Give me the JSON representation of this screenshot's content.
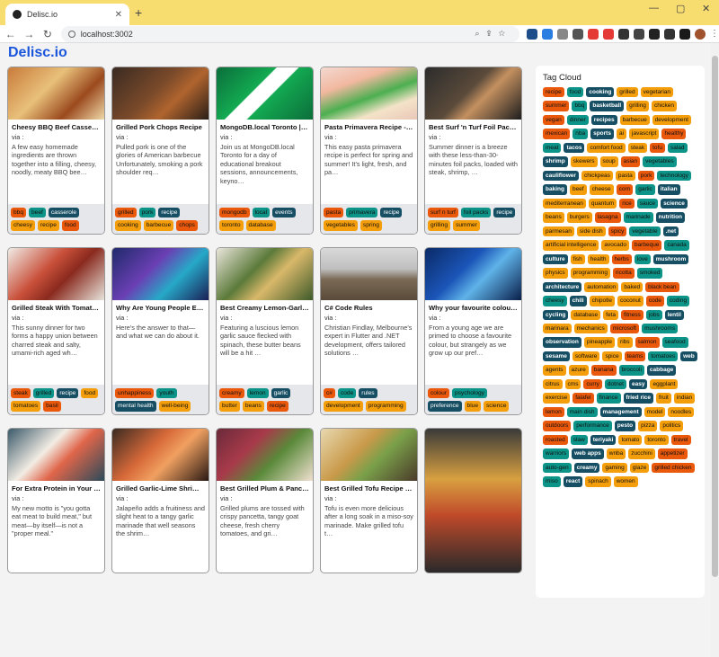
{
  "browser": {
    "tab_title": "Delisc.io",
    "tab_close": "✕",
    "new_tab": "+",
    "url": "localhost:3002",
    "back": "←",
    "forward": "→",
    "reload": "↻",
    "win_min": "—",
    "win_max": "▢",
    "win_close": "✕"
  },
  "brand": "Delisc.io",
  "colors": {
    "orange": "#f59e0b",
    "red": "#ea580c",
    "teal": "#0d9488",
    "navy": "#164e63",
    "green": "#a7f3d0",
    "yellow": "#fbbf24"
  },
  "cards": [
    {
      "title": "Cheesy BBQ Beef Casserol…",
      "via": "via :",
      "desc": "A few easy homemade ingredients are thrown together into a filling, cheesy, noodly, meaty BBQ bee…",
      "tags": [
        [
          "bbq",
          "red"
        ],
        [
          "beef",
          "teal"
        ],
        [
          "casserole",
          "navy"
        ],
        [
          "cheesy",
          "orange"
        ],
        [
          "recipe",
          "orange"
        ],
        [
          "food",
          "red"
        ]
      ]
    },
    {
      "title": "Grilled Pork Chops Recipe",
      "via": "via :",
      "desc": "Pulled pork is one of the glories of American barbecue Unfortunately, smoking a pork shoulder req…",
      "tags": [
        [
          "grilled",
          "red"
        ],
        [
          "pork",
          "teal"
        ],
        [
          "recipe",
          "navy"
        ],
        [
          "cooking",
          "orange"
        ],
        [
          "barbecue",
          "orange"
        ],
        [
          "chops",
          "red"
        ]
      ]
    },
    {
      "title": "MongoDB.local Toronto | …",
      "via": "via :",
      "desc": "Join us at MongoDB.local Toronto for a day of educational breakout sessions, announcements, keyno…",
      "tags": [
        [
          "mongodb",
          "red"
        ],
        [
          "local",
          "teal"
        ],
        [
          "events",
          "navy"
        ],
        [
          "toronto",
          "orange"
        ],
        [
          "database",
          "orange"
        ]
      ]
    },
    {
      "title": "Pasta Primavera Recipe - L…",
      "via": "via :",
      "desc": "This easy pasta primavera recipe is perfect for spring and summer! It's light, fresh, and pa…",
      "tags": [
        [
          "pasta",
          "red"
        ],
        [
          "primavera",
          "teal"
        ],
        [
          "recipe",
          "navy"
        ],
        [
          "vegetables",
          "orange"
        ],
        [
          "spring",
          "orange"
        ]
      ]
    },
    {
      "title": "Best Surf 'n Turf Foil Packs…",
      "via": "via :",
      "desc": "Summer dinner is a breeze with these less-than-30-minutes foil packs, loaded with steak, shrimp, …",
      "tags": [
        [
          "surf n turf",
          "red"
        ],
        [
          "foil packs",
          "teal"
        ],
        [
          "recipe",
          "navy"
        ],
        [
          "grilling",
          "orange"
        ],
        [
          "summer",
          "orange"
        ]
      ]
    },
    {
      "title": "Grilled Steak With Tomato…",
      "via": "via :",
      "desc": "This sunny dinner for two forms a happy union between charred steak and salty, umami-rich aged wh…",
      "tags": [
        [
          "steak",
          "red"
        ],
        [
          "grilled",
          "teal"
        ],
        [
          "recipe",
          "navy"
        ],
        [
          "food",
          "orange"
        ],
        [
          "tomatoes",
          "orange"
        ],
        [
          "basil",
          "red"
        ]
      ]
    },
    {
      "title": "Why Are Young People Ev…",
      "via": "via :",
      "desc": "Here's the answer to that—and what we can do about it.",
      "tags": [
        [
          "unhappiness",
          "red"
        ],
        [
          "youth",
          "teal"
        ],
        [
          "mental health",
          "navy"
        ],
        [
          "well-being",
          "orange"
        ]
      ]
    },
    {
      "title": "Best Creamy Lemon-Garlic…",
      "via": "via :",
      "desc": "Featuring a luscious lemon garlic sauce flecked with spinach, these butter beans will be a hit …",
      "tags": [
        [
          "creamy",
          "red"
        ],
        [
          "lemon",
          "teal"
        ],
        [
          "garlic",
          "navy"
        ],
        [
          "butter",
          "orange"
        ],
        [
          "beans",
          "orange"
        ],
        [
          "recipe",
          "red"
        ]
      ]
    },
    {
      "title": "C# Code Rules",
      "via": "via :",
      "desc": "Christian Findlay, Melbourne's expert in Flutter and .NET development, offers tailored solutions …",
      "tags": [
        [
          "c#",
          "red"
        ],
        [
          "code",
          "teal"
        ],
        [
          "rules",
          "navy"
        ],
        [
          "development",
          "orange"
        ],
        [
          "programming",
          "orange"
        ]
      ]
    },
    {
      "title": "Why your favourite colour…",
      "via": "via :",
      "desc": "From a young age we are primed to choose a favourite colour, but strangely as we grow up our pref…",
      "tags": [
        [
          "colour",
          "red"
        ],
        [
          "psychology",
          "teal"
        ],
        [
          "preference",
          "navy"
        ],
        [
          "blue",
          "orange"
        ],
        [
          "science",
          "orange"
        ]
      ]
    },
    {
      "title": "For Extra Protein in Your B…",
      "via": "via :",
      "desc": "My new motto is \"you gotta eat meat to build meat,\" but meat—by itself—is not a \"proper meal.\"",
      "tags": []
    },
    {
      "title": "Grilled Garlic-Lime Shrimp…",
      "via": "via :",
      "desc": "Jalapeño adds a fruitiness and slight heat to a tangy garlic marinade that well seasons the shrim…",
      "tags": []
    },
    {
      "title": "Best Grilled Plum & Pance…",
      "via": "via :",
      "desc": "Grilled plums are tossed with crispy pancetta, tangy goat cheese, fresh cherry tomatoes, and gri…",
      "tags": []
    },
    {
      "title": "Best Grilled Tofu Recipe - …",
      "via": "via :",
      "desc": "Tofu is even more delicious after a long soak in a miso-soy marinade. Make grilled tofu t…",
      "tags": []
    },
    {
      "title": "",
      "via": "",
      "desc": "",
      "tags": []
    }
  ],
  "tag_cloud": {
    "title": "Tag Cloud",
    "tags": [
      [
        "recipe",
        "red"
      ],
      [
        "food",
        "teal"
      ],
      [
        "cooking",
        "navy"
      ],
      [
        "grilled",
        "orange"
      ],
      [
        "vegetarian",
        "orange"
      ],
      [
        "summer",
        "red"
      ],
      [
        "bbq",
        "teal"
      ],
      [
        "basketball",
        "navy"
      ],
      [
        "grilling",
        "orange"
      ],
      [
        "chicken",
        "orange"
      ],
      [
        "vegan",
        "red"
      ],
      [
        "dinner",
        "teal"
      ],
      [
        "recipes",
        "navy"
      ],
      [
        "barbecue",
        "orange"
      ],
      [
        "development",
        "orange"
      ],
      [
        "mexican",
        "red"
      ],
      [
        "nba",
        "teal"
      ],
      [
        "sports",
        "navy"
      ],
      [
        "ai",
        "orange"
      ],
      [
        "javascript",
        "orange"
      ],
      [
        "healthy",
        "red"
      ],
      [
        "meat",
        "teal"
      ],
      [
        "tacos",
        "navy"
      ],
      [
        "comfort food",
        "orange"
      ],
      [
        "steak",
        "orange"
      ],
      [
        "tofu",
        "red"
      ],
      [
        "salad",
        "teal"
      ],
      [
        "shrimp",
        "navy"
      ],
      [
        "skewers",
        "orange"
      ],
      [
        "soup",
        "orange"
      ],
      [
        "asian",
        "red"
      ],
      [
        "vegetables",
        "teal"
      ],
      [
        "cauliflower",
        "navy"
      ],
      [
        "chickpeas",
        "orange"
      ],
      [
        "pasta",
        "orange"
      ],
      [
        "pork",
        "red"
      ],
      [
        "technology",
        "teal"
      ],
      [
        "baking",
        "navy"
      ],
      [
        "beef",
        "orange"
      ],
      [
        "cheese",
        "orange"
      ],
      [
        "corn",
        "red"
      ],
      [
        "garlic",
        "teal"
      ],
      [
        "italian",
        "navy"
      ],
      [
        "mediterranean",
        "orange"
      ],
      [
        "quantum",
        "orange"
      ],
      [
        "rice",
        "red"
      ],
      [
        "sauce",
        "teal"
      ],
      [
        "science",
        "navy"
      ],
      [
        "beans",
        "orange"
      ],
      [
        "burgers",
        "orange"
      ],
      [
        "lasagna",
        "red"
      ],
      [
        "marinade",
        "teal"
      ],
      [
        "nutrition",
        "navy"
      ],
      [
        "parmesan",
        "orange"
      ],
      [
        "side dish",
        "orange"
      ],
      [
        "spicy",
        "red"
      ],
      [
        "vegetable",
        "teal"
      ],
      [
        ".net",
        "navy"
      ],
      [
        "artificial intelligence",
        "orange"
      ],
      [
        "avocado",
        "orange"
      ],
      [
        "barbeque",
        "red"
      ],
      [
        "canada",
        "teal"
      ],
      [
        "culture",
        "navy"
      ],
      [
        "fish",
        "orange"
      ],
      [
        "health",
        "orange"
      ],
      [
        "herbs",
        "red"
      ],
      [
        "love",
        "teal"
      ],
      [
        "mushroom",
        "navy"
      ],
      [
        "physics",
        "orange"
      ],
      [
        "programming",
        "orange"
      ],
      [
        "ricotta",
        "red"
      ],
      [
        "smoked",
        "teal"
      ],
      [
        "architecture",
        "navy"
      ],
      [
        "automation",
        "orange"
      ],
      [
        "baked",
        "orange"
      ],
      [
        "black bean",
        "red"
      ],
      [
        "cheesy",
        "teal"
      ],
      [
        "chili",
        "navy"
      ],
      [
        "chipotle",
        "orange"
      ],
      [
        "coconut",
        "orange"
      ],
      [
        "code",
        "red"
      ],
      [
        "coding",
        "teal"
      ],
      [
        "cycling",
        "navy"
      ],
      [
        "database",
        "orange"
      ],
      [
        "feta",
        "orange"
      ],
      [
        "fitness",
        "red"
      ],
      [
        "jobs",
        "teal"
      ],
      [
        "lentil",
        "navy"
      ],
      [
        "marinara",
        "orange"
      ],
      [
        "mechanics",
        "orange"
      ],
      [
        "microsoft",
        "red"
      ],
      [
        "mushrooms",
        "teal"
      ],
      [
        "observation",
        "navy"
      ],
      [
        "pineapple",
        "orange"
      ],
      [
        "ribs",
        "orange"
      ],
      [
        "salmon",
        "red"
      ],
      [
        "seafood",
        "teal"
      ],
      [
        "sesame",
        "navy"
      ],
      [
        "software",
        "orange"
      ],
      [
        "spice",
        "orange"
      ],
      [
        "teams",
        "red"
      ],
      [
        "tomatoes",
        "teal"
      ],
      [
        "web",
        "navy"
      ],
      [
        "agents",
        "orange"
      ],
      [
        "azure",
        "orange"
      ],
      [
        "banana",
        "red"
      ],
      [
        "broccoli",
        "teal"
      ],
      [
        "cabbage",
        "navy"
      ],
      [
        "citrus",
        "orange"
      ],
      [
        "cms",
        "orange"
      ],
      [
        "curry",
        "red"
      ],
      [
        "dotnet",
        "teal"
      ],
      [
        "easy",
        "navy"
      ],
      [
        "eggplant",
        "orange"
      ],
      [
        "exercise",
        "orange"
      ],
      [
        "falafel",
        "red"
      ],
      [
        "finance",
        "teal"
      ],
      [
        "fried rice",
        "navy"
      ],
      [
        "fruit",
        "orange"
      ],
      [
        "indian",
        "orange"
      ],
      [
        "lemon",
        "red"
      ],
      [
        "main dish",
        "teal"
      ],
      [
        "management",
        "navy"
      ],
      [
        "model",
        "orange"
      ],
      [
        "noodles",
        "orange"
      ],
      [
        "outdoors",
        "red"
      ],
      [
        "performance",
        "teal"
      ],
      [
        "pesto",
        "navy"
      ],
      [
        "pizza",
        "orange"
      ],
      [
        "politics",
        "orange"
      ],
      [
        "roasted",
        "red"
      ],
      [
        "slaw",
        "teal"
      ],
      [
        "teriyaki",
        "navy"
      ],
      [
        "tomato",
        "orange"
      ],
      [
        "toronto",
        "orange"
      ],
      [
        "travel",
        "red"
      ],
      [
        "warriors",
        "teal"
      ],
      [
        "web apps",
        "navy"
      ],
      [
        "wnba",
        "orange"
      ],
      [
        "zucchini",
        "orange"
      ],
      [
        "appetizer",
        "red"
      ],
      [
        "auto-gen",
        "teal"
      ],
      [
        "creamy",
        "navy"
      ],
      [
        "gaming",
        "orange"
      ],
      [
        "glaze",
        "orange"
      ],
      [
        "grilled chicken",
        "red"
      ],
      [
        "miso",
        "teal"
      ],
      [
        "react",
        "navy"
      ],
      [
        "spinach",
        "orange"
      ],
      [
        "women",
        "orange"
      ]
    ]
  }
}
